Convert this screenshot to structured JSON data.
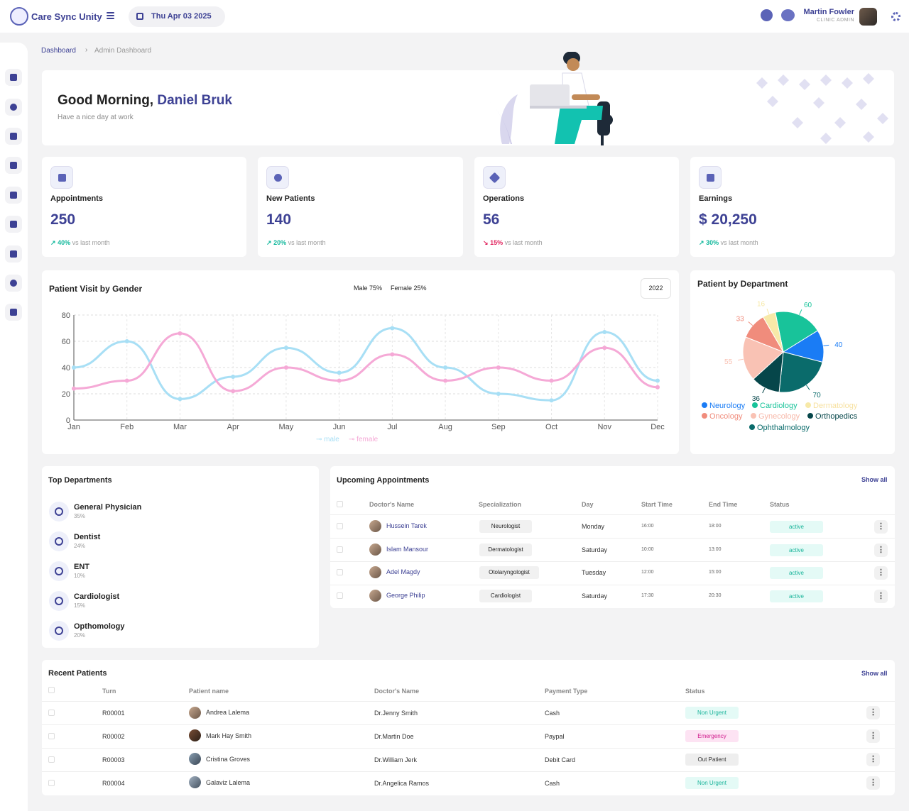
{
  "app": {
    "name": "Care Sync Unity",
    "date": "Thu Apr 03 2025"
  },
  "user": {
    "name": "Martin Fowler",
    "role": "CLINIC ADMIN"
  },
  "breadcrumb": {
    "root": "Dashboard",
    "separator": "›",
    "current": "Admin Dashboard"
  },
  "welcome": {
    "greeting": "Good Morning,",
    "name": "Daniel Bruk",
    "subtitle": "Have a nice day at work"
  },
  "stats": [
    {
      "label": "Appointments",
      "value": "250",
      "trend": "40%",
      "trend_dir": "up",
      "trend_text": "vs last month",
      "icon": "calendar-icon"
    },
    {
      "label": "New Patients",
      "value": "140",
      "trend": "20%",
      "trend_dir": "up",
      "trend_text": "vs last month",
      "icon": "patient-icon"
    },
    {
      "label": "Operations",
      "value": "56",
      "trend": "15%",
      "trend_dir": "down",
      "trend_text": "vs last month",
      "icon": "scissors-icon"
    },
    {
      "label": "Earnings",
      "value": "$ 20,250",
      "trend": "30%",
      "trend_dir": "up",
      "trend_text": "vs last month",
      "icon": "wallet-icon"
    }
  ],
  "gender_chart": {
    "title": "Patient Visit by Gender",
    "summary_male": "Male 75%",
    "summary_female": "Female 25%",
    "year": "2022",
    "legend_male": "male",
    "legend_female": "female"
  },
  "department_chart": {
    "title": "Patient by Department"
  },
  "chart_data": [
    {
      "type": "line",
      "x": [
        "Jan",
        "Feb",
        "Mar",
        "Apr",
        "May",
        "Jun",
        "Jul",
        "Aug",
        "Sep",
        "Oct",
        "Nov",
        "Dec"
      ],
      "ylim": [
        0,
        80
      ],
      "yticks": [
        0,
        20,
        40,
        60,
        80
      ],
      "grid": true,
      "series": [
        {
          "name": "male",
          "color": "#a8dff5",
          "values": [
            40,
            60,
            16,
            33,
            55,
            36,
            70,
            40,
            20,
            15,
            67,
            30
          ]
        },
        {
          "name": "female",
          "color": "#f5a9d6",
          "values": [
            24,
            30,
            66,
            22,
            40,
            30,
            50,
            30,
            40,
            30,
            55,
            25
          ]
        }
      ]
    },
    {
      "type": "pie",
      "slices": [
        {
          "name": "Neurology",
          "value": 40,
          "color": "#1a7cf5"
        },
        {
          "name": "Cardiology",
          "value": 60,
          "color": "#18c39a"
        },
        {
          "name": "Dermatology",
          "value": 16,
          "color": "#f7e9a8"
        },
        {
          "name": "Oncology",
          "value": 33,
          "color": "#f08c7c"
        },
        {
          "name": "Gynecology",
          "value": 55,
          "color": "#f9c2b4"
        },
        {
          "name": "Orthopedics",
          "value": 36,
          "color": "#06464a"
        },
        {
          "name": "Ophthalmology",
          "value": 70,
          "color": "#0a6b6b"
        }
      ]
    }
  ],
  "top_departments": {
    "title": "Top Departments",
    "items": [
      {
        "name": "General Physician",
        "percent": "35%",
        "icon": "stethoscope-icon"
      },
      {
        "name": "Dentist",
        "percent": "24%",
        "icon": "tooth-icon"
      },
      {
        "name": "ENT",
        "percent": "10%",
        "icon": "ear-icon"
      },
      {
        "name": "Cardiologist",
        "percent": "15%",
        "icon": "heart-icon"
      },
      {
        "name": "Opthomology",
        "percent": "20%",
        "icon": "eye-icon"
      }
    ]
  },
  "appointments": {
    "title": "Upcoming Appointments",
    "show_all": "Show all",
    "headers": [
      "Doctor's Name",
      "Specialization",
      "Day",
      "Start Time",
      "End Time",
      "Status"
    ],
    "rows": [
      {
        "doctor": "Hussein Tarek",
        "spec": "Neurologist",
        "day": "Monday",
        "start": "16:00",
        "end": "18:00",
        "status": "active"
      },
      {
        "doctor": "Islam Mansour",
        "spec": "Dermatologist",
        "day": "Saturday",
        "start": "10:00",
        "end": "13:00",
        "status": "active"
      },
      {
        "doctor": "Adel Magdy",
        "spec": "Otolaryngologist",
        "day": "Tuesday",
        "start": "12:00",
        "end": "15:00",
        "status": "active"
      },
      {
        "doctor": "George Philip",
        "spec": "Cardiologist",
        "day": "Saturday",
        "start": "17:30",
        "end": "20:30",
        "status": "active"
      }
    ]
  },
  "recent": {
    "title": "Recent Patients",
    "show_all": "Show all",
    "headers": [
      "Turn",
      "Patient name",
      "Doctor's Name",
      "Payment Type",
      "Status"
    ],
    "rows": [
      {
        "turn": "R00001",
        "patient": "Andrea Lalema",
        "doctor": "Dr.Jenny Smith",
        "payment": "Cash",
        "status": "Non Urgent",
        "status_color": "#e4faf6",
        "status_text": "#19b49a"
      },
      {
        "turn": "R00002",
        "patient": "Mark Hay Smith",
        "doctor": "Dr.Martin Doe",
        "payment": "Paypal",
        "status": "Emergency",
        "status_color": "#fde3f3",
        "status_text": "#d0198b"
      },
      {
        "turn": "R00003",
        "patient": "Cristina Groves",
        "doctor": "Dr.William Jerk",
        "payment": "Debit Card",
        "status": "Out Patient",
        "status_color": "#eeeeee",
        "status_text": "#333333"
      },
      {
        "turn": "R00004",
        "patient": "Galaviz Lalema",
        "doctor": "Dr.Angelica Ramos",
        "payment": "Cash",
        "status": "Non Urgent",
        "status_color": "#e4faf6",
        "status_text": "#19b49a"
      }
    ]
  }
}
